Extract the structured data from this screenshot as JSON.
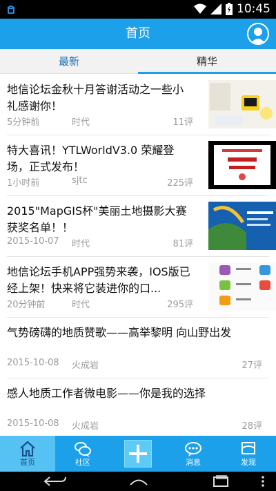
{
  "status_bar": {
    "time": "10:45"
  },
  "header": {
    "title": "首页"
  },
  "tabs": [
    {
      "label": "最新",
      "active": false
    },
    {
      "label": "精华",
      "active": true
    }
  ],
  "feed": [
    {
      "title": "地信论坛金秋十月答谢活动之一些小礼感谢你！",
      "time": "5分钟前",
      "author": "时代",
      "comments": "11评",
      "thumbnail": "gift-photo"
    },
    {
      "title": "特大喜讯！YTLWorldV3.0 荣耀登场，正式发布！",
      "time": "1小时前",
      "author": "sjtc",
      "comments": "225评",
      "thumbnail": "ytlworld-banner"
    },
    {
      "title": "2015\"MapGIS杯\"美丽土地摄影大赛获奖名单！！",
      "time": "2015-10-07",
      "author": "时代",
      "comments": "81评",
      "thumbnail": "photo-contest-banner"
    },
    {
      "title": "地信论坛手机APP强势来袭，IOS版已经上架！快来将它装进你的口...",
      "time": "20分钟前",
      "author": "时代",
      "comments": "295评",
      "thumbnail": "app-icons"
    },
    {
      "title": "气势磅礴的地质赞歌——高举黎明 向山野出发",
      "time": "2015-10-08",
      "author": "火成岩",
      "comments": "27评",
      "thumbnail": ""
    },
    {
      "title": "感人地质工作者微电影——你是我的选择",
      "time": "2015-10-08",
      "author": "火成岩",
      "comments": "28评",
      "thumbnail": ""
    }
  ],
  "bottom_nav": [
    {
      "label": "首页",
      "icon": "home-icon",
      "active": true
    },
    {
      "label": "社区",
      "icon": "chat-bubbles-icon",
      "active": false
    },
    {
      "label": "",
      "icon": "plus-icon",
      "active": false
    },
    {
      "label": "消息",
      "icon": "message-icon",
      "active": false
    },
    {
      "label": "发现",
      "icon": "flag-icon",
      "active": false
    }
  ],
  "colors": {
    "accent": "#1da0ea",
    "meta_text": "#9a9a9a",
    "tab_inactive": "#1a6fb6"
  }
}
